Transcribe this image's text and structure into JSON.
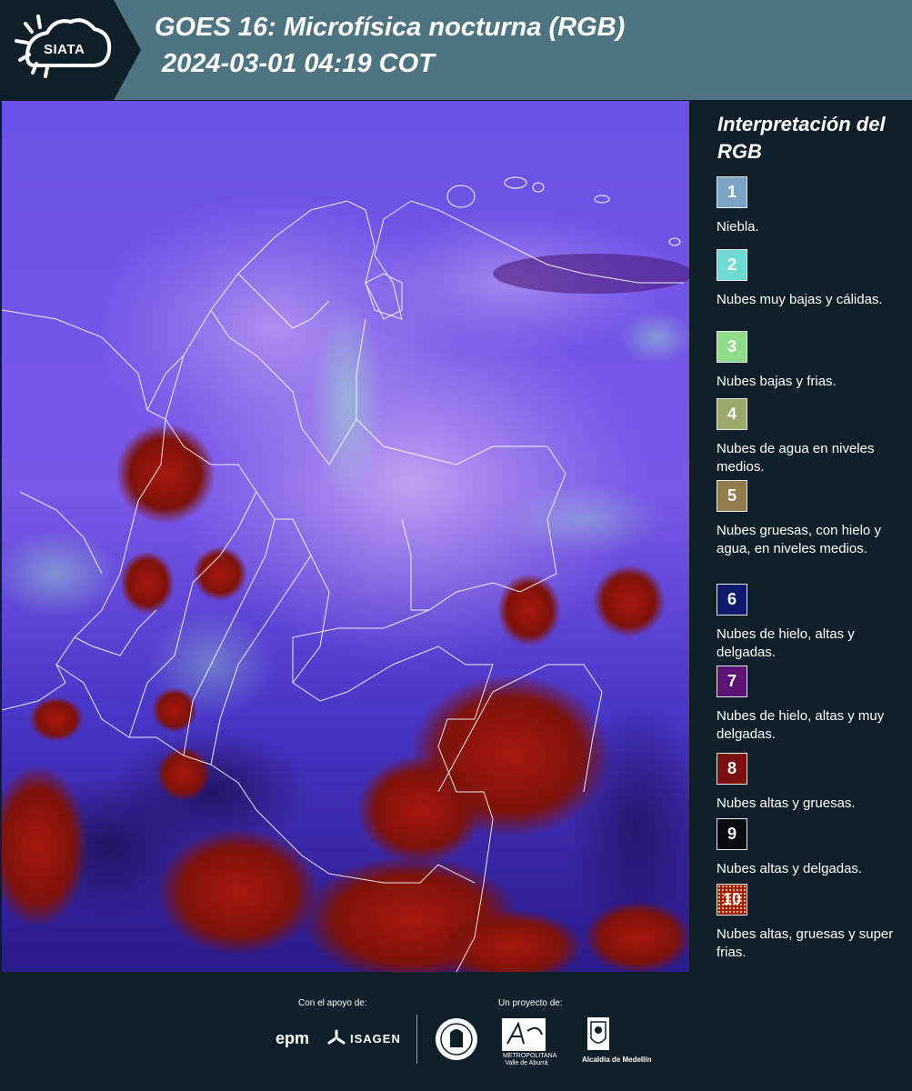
{
  "header": {
    "title_line1": "GOES 16: Microfísica nocturna (RGB)",
    "title_line2": " 2024-03-01 04:19 COT",
    "logo_text": "SIATA",
    "background_color": "#4d7480"
  },
  "map": {
    "description_icon": "satellite-rgb-image"
  },
  "legend": {
    "title": "Interpretación del RGB",
    "items": [
      {
        "number": "1",
        "color": "#7aa3c6",
        "label": "Niebla."
      },
      {
        "number": "2",
        "color": "#6fd9d3",
        "label": "Nubes muy bajas y cálidas."
      },
      {
        "number": "3",
        "color": "#8fdc8c",
        "label": "Nubes bajas y frias."
      },
      {
        "number": "4",
        "color": "#9ba86c",
        "label": "Nubes de agua en niveles medios."
      },
      {
        "number": "5",
        "color": "#927b4c",
        "label": "Nubes gruesas, con hielo y agua, en niveles medios."
      },
      {
        "number": "6",
        "color": "#101a6c",
        "label": "Nubes de hielo, altas y delgadas."
      },
      {
        "number": "7",
        "color": "#5c1373",
        "label": "Nubes de hielo, altas y muy delgadas."
      },
      {
        "number": "8",
        "color": "#7a0f10",
        "label": "Nubes altas y gruesas."
      },
      {
        "number": "9",
        "color": "#0a0a12",
        "label": "Nubes altas y delgadas."
      },
      {
        "number": "10",
        "color": "#a11a0c",
        "label": "Nubes altas, gruesas y super frias."
      }
    ]
  },
  "footer": {
    "support_label": "Con el apoyo de:",
    "project_label": "Un proyecto de:",
    "epm": "epm",
    "isagen": "ISAGEN",
    "area_sub": "METROPOLITANA Valle de Aburrá",
    "alcaldia": "Alcaldía de Medellín"
  }
}
